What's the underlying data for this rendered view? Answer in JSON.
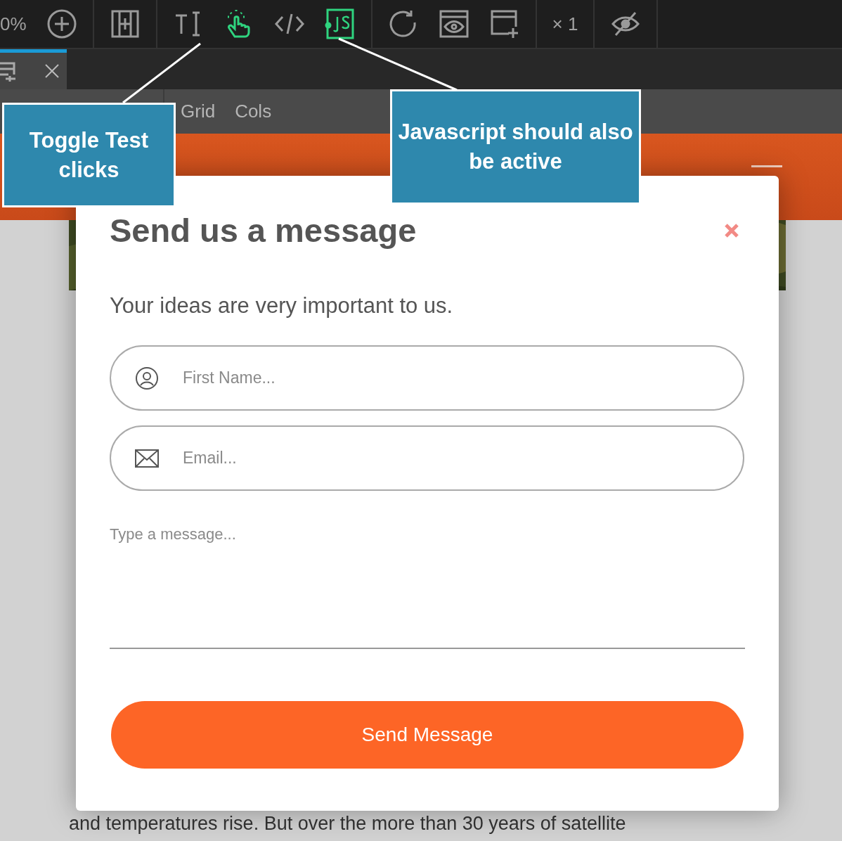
{
  "toolbar": {
    "groups": [
      [
        {
          "kind": "zoom-label",
          "text": "0%"
        },
        {
          "kind": "zoom-in",
          "active": false
        }
      ],
      [
        {
          "kind": "frame",
          "active": false
        }
      ],
      [
        {
          "kind": "text-tool",
          "active": false
        },
        {
          "kind": "test-clicks",
          "active": true
        },
        {
          "kind": "code",
          "active": false
        },
        {
          "kind": "javascript",
          "active": true
        }
      ],
      [
        {
          "kind": "reload",
          "active": false
        },
        {
          "kind": "preview",
          "active": false
        },
        {
          "kind": "add-frame",
          "active": false
        }
      ],
      [
        {
          "kind": "multiplier",
          "text": "× 1"
        }
      ],
      [
        {
          "kind": "hide",
          "active": false
        }
      ]
    ]
  },
  "tabs": [
    {
      "selected": true
    }
  ],
  "menu": [
    "Grid",
    "Cols"
  ],
  "article": {
    "last_line": "and temperatures rise. But over the more than 30 years of satellite"
  },
  "modal": {
    "title": "Send us a message",
    "subtitle": "Your ideas are very important to us.",
    "fields": [
      {
        "kind": "name",
        "placeholder": "First Name..."
      },
      {
        "kind": "email",
        "placeholder": "Email..."
      }
    ],
    "message": {
      "placeholder": "Type a message..."
    },
    "button": "Send Message"
  },
  "callouts": [
    {
      "text": "Toggle Test clicks"
    },
    {
      "text": "Javascript should also be active"
    }
  ]
}
